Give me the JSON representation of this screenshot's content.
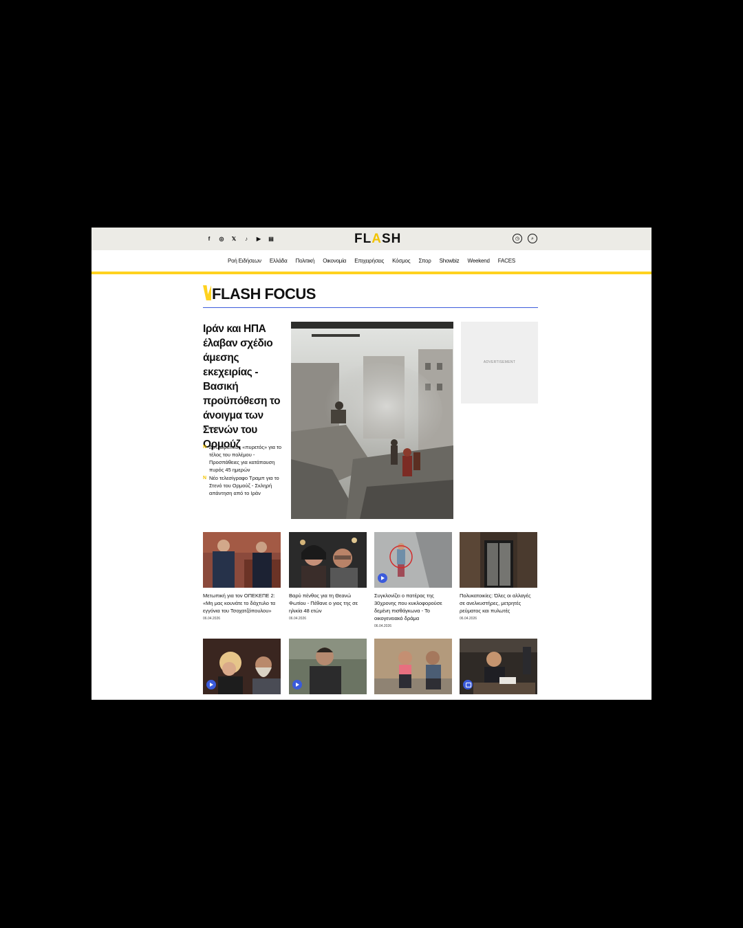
{
  "header": {
    "social_icons": [
      "facebook-icon",
      "instagram-icon",
      "x-icon",
      "tiktok-icon",
      "youtube-icon",
      "podcast-icon"
    ],
    "logo": {
      "text_left": "FL",
      "text_accent": "A",
      "text_right": "SH"
    },
    "tools": [
      "clock-icon",
      "search-icon"
    ]
  },
  "nav": {
    "items": [
      "Ροή Ειδήσεων",
      "Ελλάδα",
      "Πολιτική",
      "Οικονομία",
      "Επιχειρήσεις",
      "Κόσμος",
      "Σπορ",
      "Showbiz",
      "Weekend",
      "FACES"
    ]
  },
  "section": {
    "title": "FLASH FOCUS"
  },
  "lead": {
    "title": "Ιράν και ΗΠΑ έλαβαν σχέδιο άμεσης εκεχειρίας - Βασική προϋπόθεση το άνοιγμα των Στενών του Ορμούζ",
    "date": "06.04.2026",
    "related": [
      "Διπλωματικός «πυρετός» για το τέλος του πολέμου - Προσπάθειες για κατάπαυση πυρός 45 ημερών",
      "Νέο τελεσίγραφο Τραμπ για το Στενό του Ορμούζ - Σκληρή απάντηση από το Ιράν"
    ]
  },
  "ad": {
    "label": "ADVERTISEMENT"
  },
  "cards": [
    {
      "title": "Μετωπική για τον ΟΠΕΚΕΠΕ 2: «Μη μας κουνάτε το δάχτυλο τα εγγόνια του Τσοχατζόπουλου»",
      "date": "06.04.2026",
      "badge": ""
    },
    {
      "title": "Βαρύ πένθος για τη Θεανώ Φωτίου - Πέθανε ο γιος της σε ηλικία 48 ετών",
      "date": "06.04.2026",
      "badge": ""
    },
    {
      "title": "Συγκλονίζει ο πατέρας της 30χρονης που κυκλοφορούσε δεμένη πισθάγκωνα - Το οικογενειακό δράμα",
      "date": "06.04.2026",
      "badge": "play"
    },
    {
      "title": "Πολυκατοικίες: Όλες οι αλλαγές σε ανελκυστήρες, μετρητές ρεύματος και πυλωτές",
      "date": "06.04.2026",
      "badge": ""
    },
    {
      "title": "",
      "date": "",
      "badge": "play"
    },
    {
      "title": "",
      "date": "",
      "badge": "play"
    },
    {
      "title": "",
      "date": "",
      "badge": ""
    },
    {
      "title": "",
      "date": "",
      "badge": "gallery"
    }
  ]
}
